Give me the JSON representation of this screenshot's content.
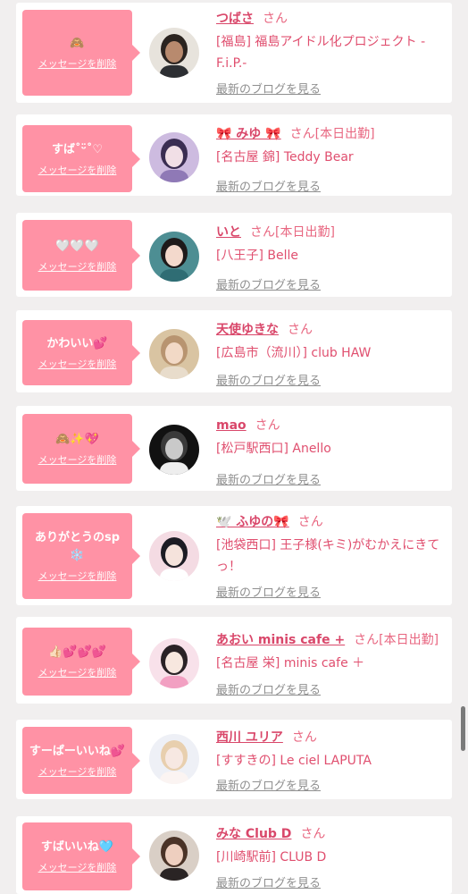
{
  "delete_label": "メッセージを削除",
  "blog_label": "最新のブログを見る",
  "san_label": "さん",
  "messages": [
    {
      "message": "🙈",
      "name": "つばさ",
      "status": "",
      "shop": "[福島] 福島アイドル化プロジェクト - F.i.P.-",
      "avatar": "avatar-man"
    },
    {
      "message": "すば˚ᵕ̈˚♡",
      "name": "🎀 みゆ 🎀",
      "status": "[本日出勤]",
      "shop": "[名古屋 錦] Teddy Bear",
      "avatar": "avatar-purple"
    },
    {
      "message": "🤍🤍🤍",
      "name": "いと",
      "status": "[本日出勤]",
      "shop": "[八王子] Belle",
      "avatar": "avatar-teal"
    },
    {
      "message": "かわいい💕",
      "name": "天使ゆきな",
      "status": "",
      "shop": "[広島市（流川）] club HAW",
      "avatar": "avatar-tan"
    },
    {
      "message": "🙈✨💖",
      "name": "mao",
      "status": "",
      "shop": "[松戸駅西口] Anello",
      "avatar": "avatar-dark"
    },
    {
      "message": "ありがとうのsp❄️",
      "name": "🕊️ ふゆの🎀",
      "status": "",
      "shop": "[池袋西口] 王子様(キミ)がむかえにきてっ！",
      "avatar": "avatar-pink"
    },
    {
      "message": "👍🏻💕💕💕",
      "name": "あおい minis cafe +",
      "status": "[本日出勤]",
      "shop": "[名古屋 栄] minis cafe ＋",
      "avatar": "avatar-light"
    },
    {
      "message": "すーぱーいいね💕",
      "name": "西川 ユリア",
      "status": "",
      "shop": "[すすきの] Le ciel LAPUTA",
      "avatar": "avatar-blonde"
    },
    {
      "message": "すばいいね🩵",
      "name": "みな Club D",
      "status": "",
      "shop": "[川崎駅前] CLUB D",
      "avatar": "avatar-brown"
    }
  ]
}
